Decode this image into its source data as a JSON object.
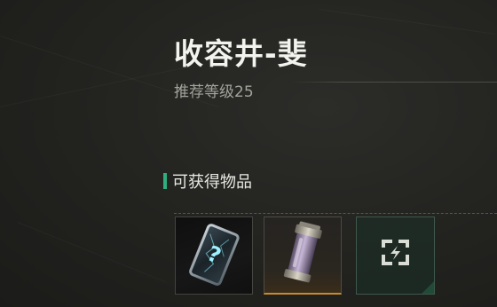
{
  "stage": {
    "title": "收容井-斐",
    "recommended_level": "推荐等级25"
  },
  "rewards": {
    "section_title": "可获得物品",
    "items": [
      {
        "icon": "mystery-card-icon"
      },
      {
        "icon": "energy-capsule-icon"
      },
      {
        "icon": "exchange-icon"
      }
    ]
  },
  "colors": {
    "accent_green": "#2fae7e",
    "rarity_orange": "#c98a2e"
  }
}
